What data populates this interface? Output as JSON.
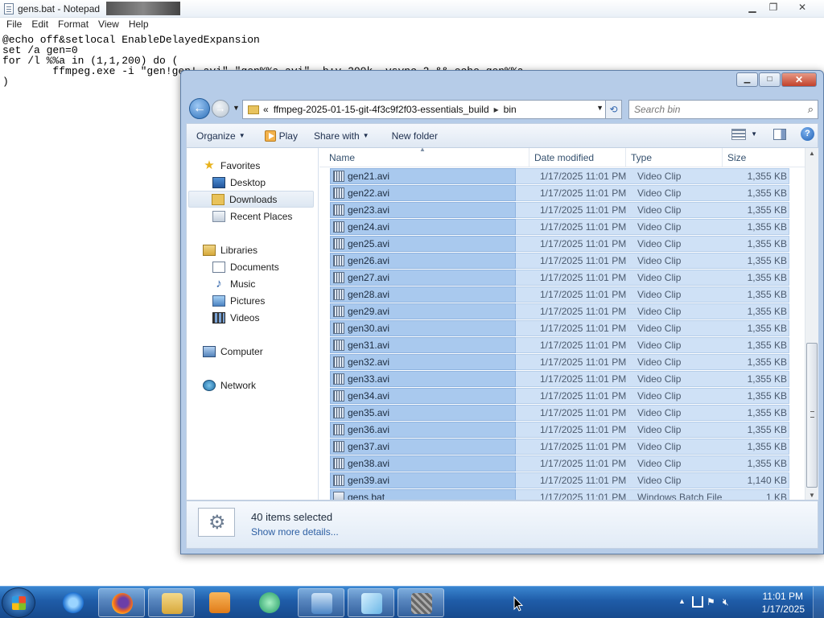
{
  "notepad": {
    "title": "gens.bat - Notepad",
    "menu": [
      "File",
      "Edit",
      "Format",
      "View",
      "Help"
    ],
    "lines": [
      "@echo off&setlocal EnableDelayedExpansion",
      "set /a gen=0",
      "for /l %%a in (1,1,200) do (",
      "        ffmpeg.exe -i \"gen!gen!.avi\" \"gen%%a.avi\" -b:v 200k -vsync 2 && echo gen%%a",
      ")"
    ]
  },
  "explorer": {
    "breadcrumb_prefix": "«",
    "path": [
      "ffmpeg-2025-01-15-git-4f3c9f2f03-essentials_build",
      "bin"
    ],
    "search_placeholder": "Search bin",
    "toolbar": {
      "organize": "Organize",
      "play": "Play",
      "share_with": "Share with",
      "new_folder": "New folder"
    },
    "nav": {
      "favorites": "Favorites",
      "desktop": "Desktop",
      "downloads": "Downloads",
      "recent_places": "Recent Places",
      "libraries": "Libraries",
      "documents": "Documents",
      "music": "Music",
      "pictures": "Pictures",
      "videos": "Videos",
      "computer": "Computer",
      "network": "Network"
    },
    "columns": {
      "name": "Name",
      "date": "Date modified",
      "type": "Type",
      "size": "Size"
    },
    "files": [
      {
        "name": "gen21.avi",
        "date": "1/17/2025 11:01 PM",
        "type": "Video Clip",
        "size": "1,355 KB"
      },
      {
        "name": "gen22.avi",
        "date": "1/17/2025 11:01 PM",
        "type": "Video Clip",
        "size": "1,355 KB"
      },
      {
        "name": "gen23.avi",
        "date": "1/17/2025 11:01 PM",
        "type": "Video Clip",
        "size": "1,355 KB"
      },
      {
        "name": "gen24.avi",
        "date": "1/17/2025 11:01 PM",
        "type": "Video Clip",
        "size": "1,355 KB"
      },
      {
        "name": "gen25.avi",
        "date": "1/17/2025 11:01 PM",
        "type": "Video Clip",
        "size": "1,355 KB"
      },
      {
        "name": "gen26.avi",
        "date": "1/17/2025 11:01 PM",
        "type": "Video Clip",
        "size": "1,355 KB"
      },
      {
        "name": "gen27.avi",
        "date": "1/17/2025 11:01 PM",
        "type": "Video Clip",
        "size": "1,355 KB"
      },
      {
        "name": "gen28.avi",
        "date": "1/17/2025 11:01 PM",
        "type": "Video Clip",
        "size": "1,355 KB"
      },
      {
        "name": "gen29.avi",
        "date": "1/17/2025 11:01 PM",
        "type": "Video Clip",
        "size": "1,355 KB"
      },
      {
        "name": "gen30.avi",
        "date": "1/17/2025 11:01 PM",
        "type": "Video Clip",
        "size": "1,355 KB"
      },
      {
        "name": "gen31.avi",
        "date": "1/17/2025 11:01 PM",
        "type": "Video Clip",
        "size": "1,355 KB"
      },
      {
        "name": "gen32.avi",
        "date": "1/17/2025 11:01 PM",
        "type": "Video Clip",
        "size": "1,355 KB"
      },
      {
        "name": "gen33.avi",
        "date": "1/17/2025 11:01 PM",
        "type": "Video Clip",
        "size": "1,355 KB"
      },
      {
        "name": "gen34.avi",
        "date": "1/17/2025 11:01 PM",
        "type": "Video Clip",
        "size": "1,355 KB"
      },
      {
        "name": "gen35.avi",
        "date": "1/17/2025 11:01 PM",
        "type": "Video Clip",
        "size": "1,355 KB"
      },
      {
        "name": "gen36.avi",
        "date": "1/17/2025 11:01 PM",
        "type": "Video Clip",
        "size": "1,355 KB"
      },
      {
        "name": "gen37.avi",
        "date": "1/17/2025 11:01 PM",
        "type": "Video Clip",
        "size": "1,355 KB"
      },
      {
        "name": "gen38.avi",
        "date": "1/17/2025 11:01 PM",
        "type": "Video Clip",
        "size": "1,355 KB"
      },
      {
        "name": "gen39.avi",
        "date": "1/17/2025 11:01 PM",
        "type": "Video Clip",
        "size": "1,140 KB"
      },
      {
        "name": "gens.bat",
        "date": "1/17/2025 11:01 PM",
        "type": "Windows Batch File",
        "size": "1 KB"
      }
    ],
    "details": {
      "count": "40 items selected",
      "more": "Show more details..."
    }
  },
  "taskbar": {
    "apps": [
      "internet-explorer",
      "firefox",
      "windows-explorer",
      "media-player",
      "media-center",
      "control-panel",
      "notepad",
      "virtual-machine"
    ],
    "time": "11:01 PM",
    "date": "1/17/2025"
  },
  "colors": {
    "selection": "#a9c9ee",
    "selection_light": "#cfe1f6",
    "taskbar": "#1f5ca8",
    "link": "#2d5fa3"
  }
}
